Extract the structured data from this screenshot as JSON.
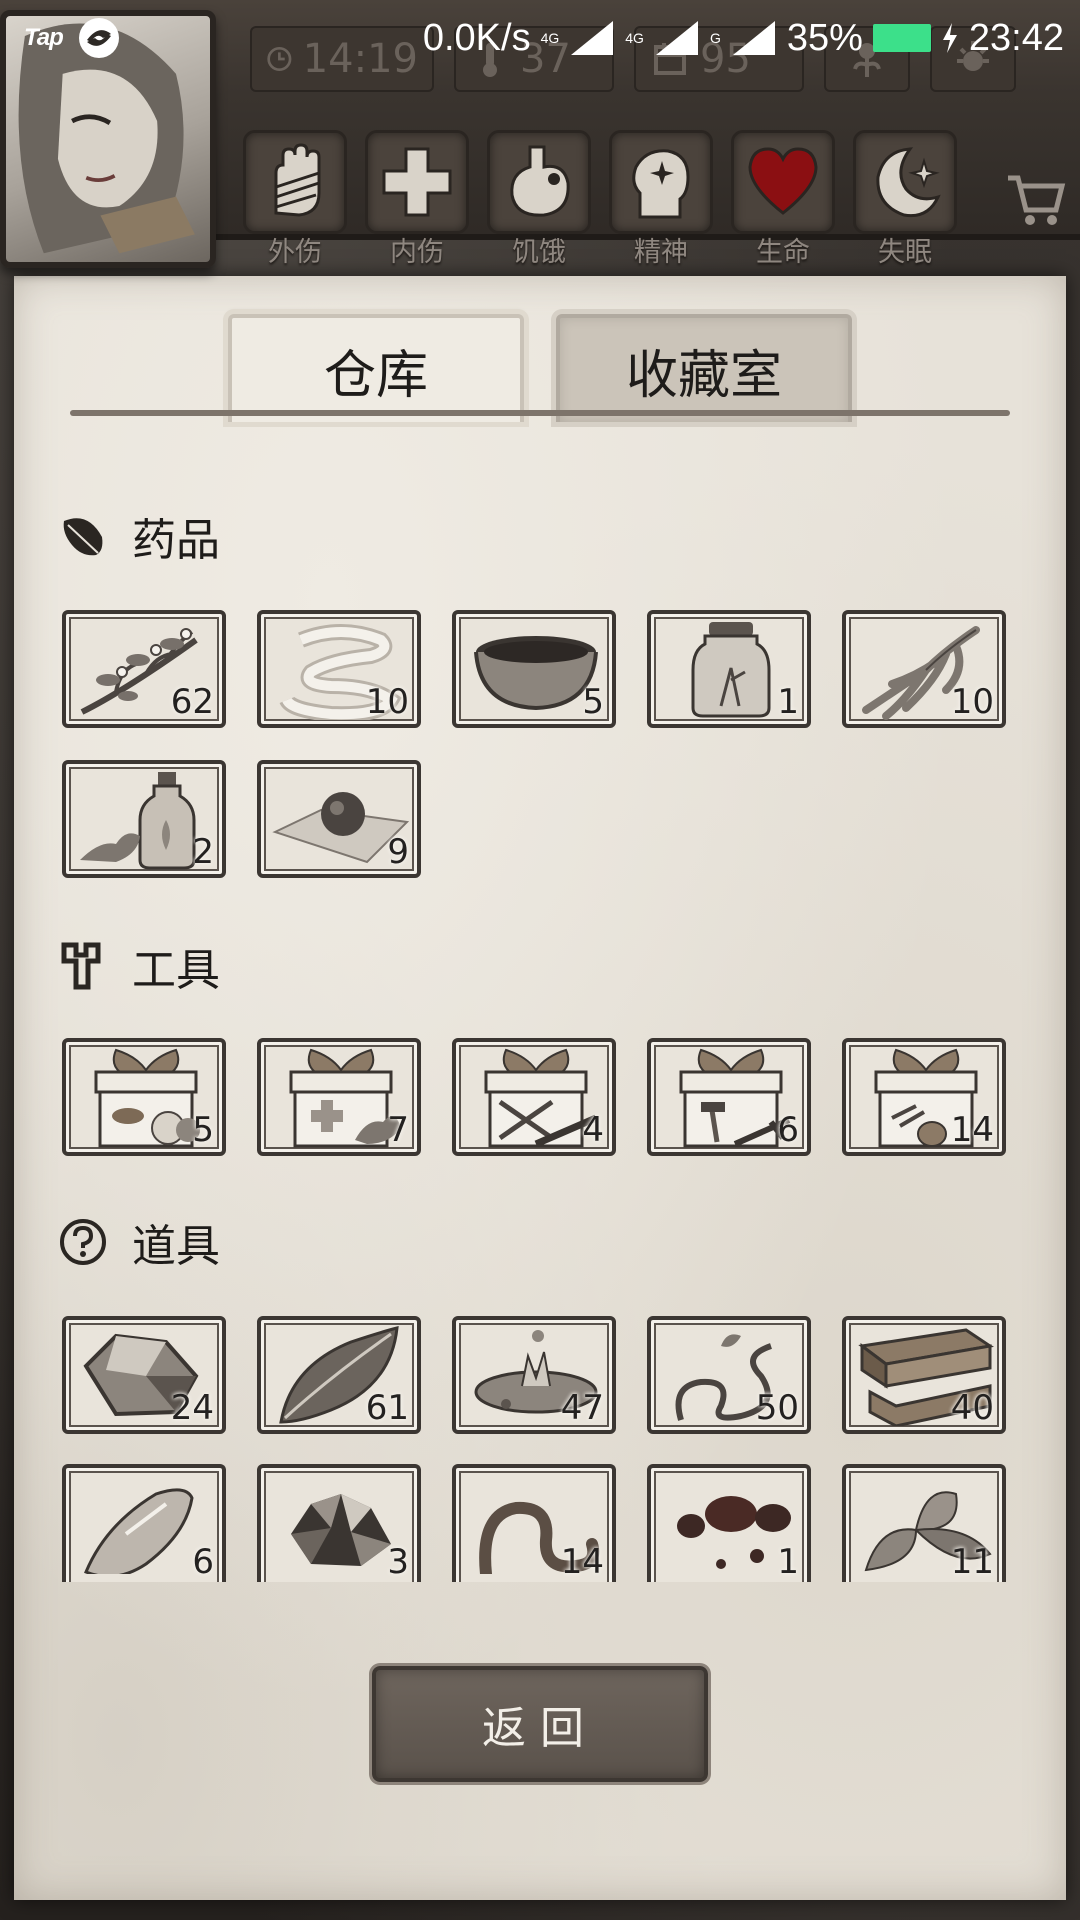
{
  "status_bar": {
    "app_badge": "Tap",
    "network_speed": "0.0K/s",
    "net_type_1": "4G",
    "net_type_2": "4G",
    "net_type_3": "G",
    "battery": "35%",
    "time": "23:42"
  },
  "hud": {
    "clock": "14:19",
    "temperature": "37",
    "day": "95",
    "status_labels": [
      "外伤",
      "内伤",
      "饥饿",
      "精神",
      "生命",
      "失眠"
    ],
    "accent_heart": "#8b0f12"
  },
  "tabs": {
    "warehouse": "仓库",
    "collection": "收藏室"
  },
  "sections": {
    "medicine": {
      "title": "药品",
      "items": [
        {
          "icon": "herb-branch-icon",
          "qty": "62"
        },
        {
          "icon": "bandage-icon",
          "qty": "10"
        },
        {
          "icon": "medicine-bowl-icon",
          "qty": "5"
        },
        {
          "icon": "herb-jar-icon",
          "qty": "1"
        },
        {
          "icon": "ginseng-root-icon",
          "qty": "10"
        },
        {
          "icon": "oil-bottle-icon",
          "qty": "2"
        },
        {
          "icon": "pill-on-paper-icon",
          "qty": "9"
        }
      ]
    },
    "tools": {
      "title": "工具",
      "items": [
        {
          "icon": "food-gift-box-icon",
          "qty": "5"
        },
        {
          "icon": "medical-gift-box-icon",
          "qty": "7"
        },
        {
          "icon": "weapon-gift-box-icon",
          "qty": "4"
        },
        {
          "icon": "tool-gift-box-icon",
          "qty": "6"
        },
        {
          "icon": "material-gift-box-icon",
          "qty": "14"
        }
      ]
    },
    "props": {
      "title": "道具",
      "items": [
        {
          "icon": "stone-icon",
          "qty": "24"
        },
        {
          "icon": "leaf-icon",
          "qty": "61"
        },
        {
          "icon": "water-splash-icon",
          "qty": "47"
        },
        {
          "icon": "vine-icon",
          "qty": "50"
        },
        {
          "icon": "wood-planks-icon",
          "qty": "40"
        },
        {
          "icon": "flint-icon",
          "qty": "6"
        },
        {
          "icon": "ore-icon",
          "qty": "3"
        },
        {
          "icon": "rope-icon",
          "qty": "14"
        },
        {
          "icon": "blood-drops-icon",
          "qty": "1"
        },
        {
          "icon": "mint-leaf-icon",
          "qty": "11"
        }
      ]
    }
  },
  "back_button": "返回"
}
